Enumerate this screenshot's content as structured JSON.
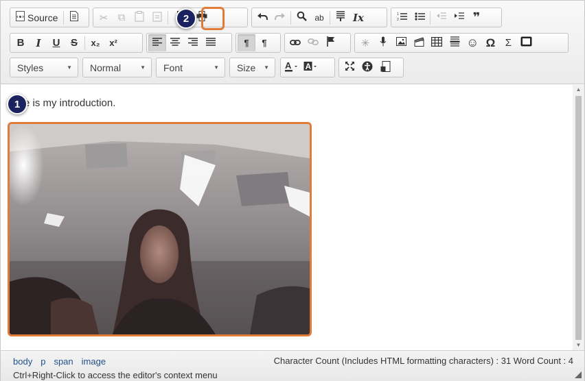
{
  "toolbar": {
    "source_label": "Source",
    "styles_label": "Styles",
    "format_label": "Normal",
    "font_label": "Font",
    "size_label": "Size"
  },
  "icons": {
    "cut": "✂",
    "copy": "⧉",
    "paste": "📋",
    "paste_text": "📋",
    "paste_word": "📋",
    "preview": "🗎",
    "print": "🖶",
    "undo": "↶",
    "redo": "↷",
    "find": "🔍",
    "replace": "ab",
    "selectall": "▤",
    "removeformat": "Ix",
    "numbered": "⒈",
    "bulleted": "•",
    "outdent": "⇤",
    "indent": "⇥",
    "blockquote": "❞",
    "bold": "B",
    "italic": "I",
    "underline": "U",
    "strike": "S",
    "subscript": "x₂",
    "superscript": "x²",
    "link": "🔗",
    "unlink": "⛓",
    "anchor": "⚑",
    "specialchar": "Ω",
    "sum": "Σ",
    "emoji": "☺",
    "table": "▦",
    "hr": "≡",
    "image": "🖼",
    "flash": "🎬",
    "audio": "🎙",
    "spinner": "✳",
    "maximize": "⛶",
    "accessibility": "ⓘ",
    "showblocks": "▥",
    "template": "▣",
    "ltr": "¶",
    "rtl": "¶"
  },
  "content": {
    "intro_text": "e is my introduction."
  },
  "status": {
    "path": [
      "body",
      "p",
      "span",
      "image"
    ],
    "counts": "Character Count (Includes HTML formatting characters) : 31 Word Count : 4",
    "hint": "Ctrl+Right-Click to access the editor's context menu"
  },
  "callouts": {
    "one": "1",
    "two": "2"
  },
  "colors": {
    "accent": "#e07b39",
    "callout": "#1b2260"
  }
}
